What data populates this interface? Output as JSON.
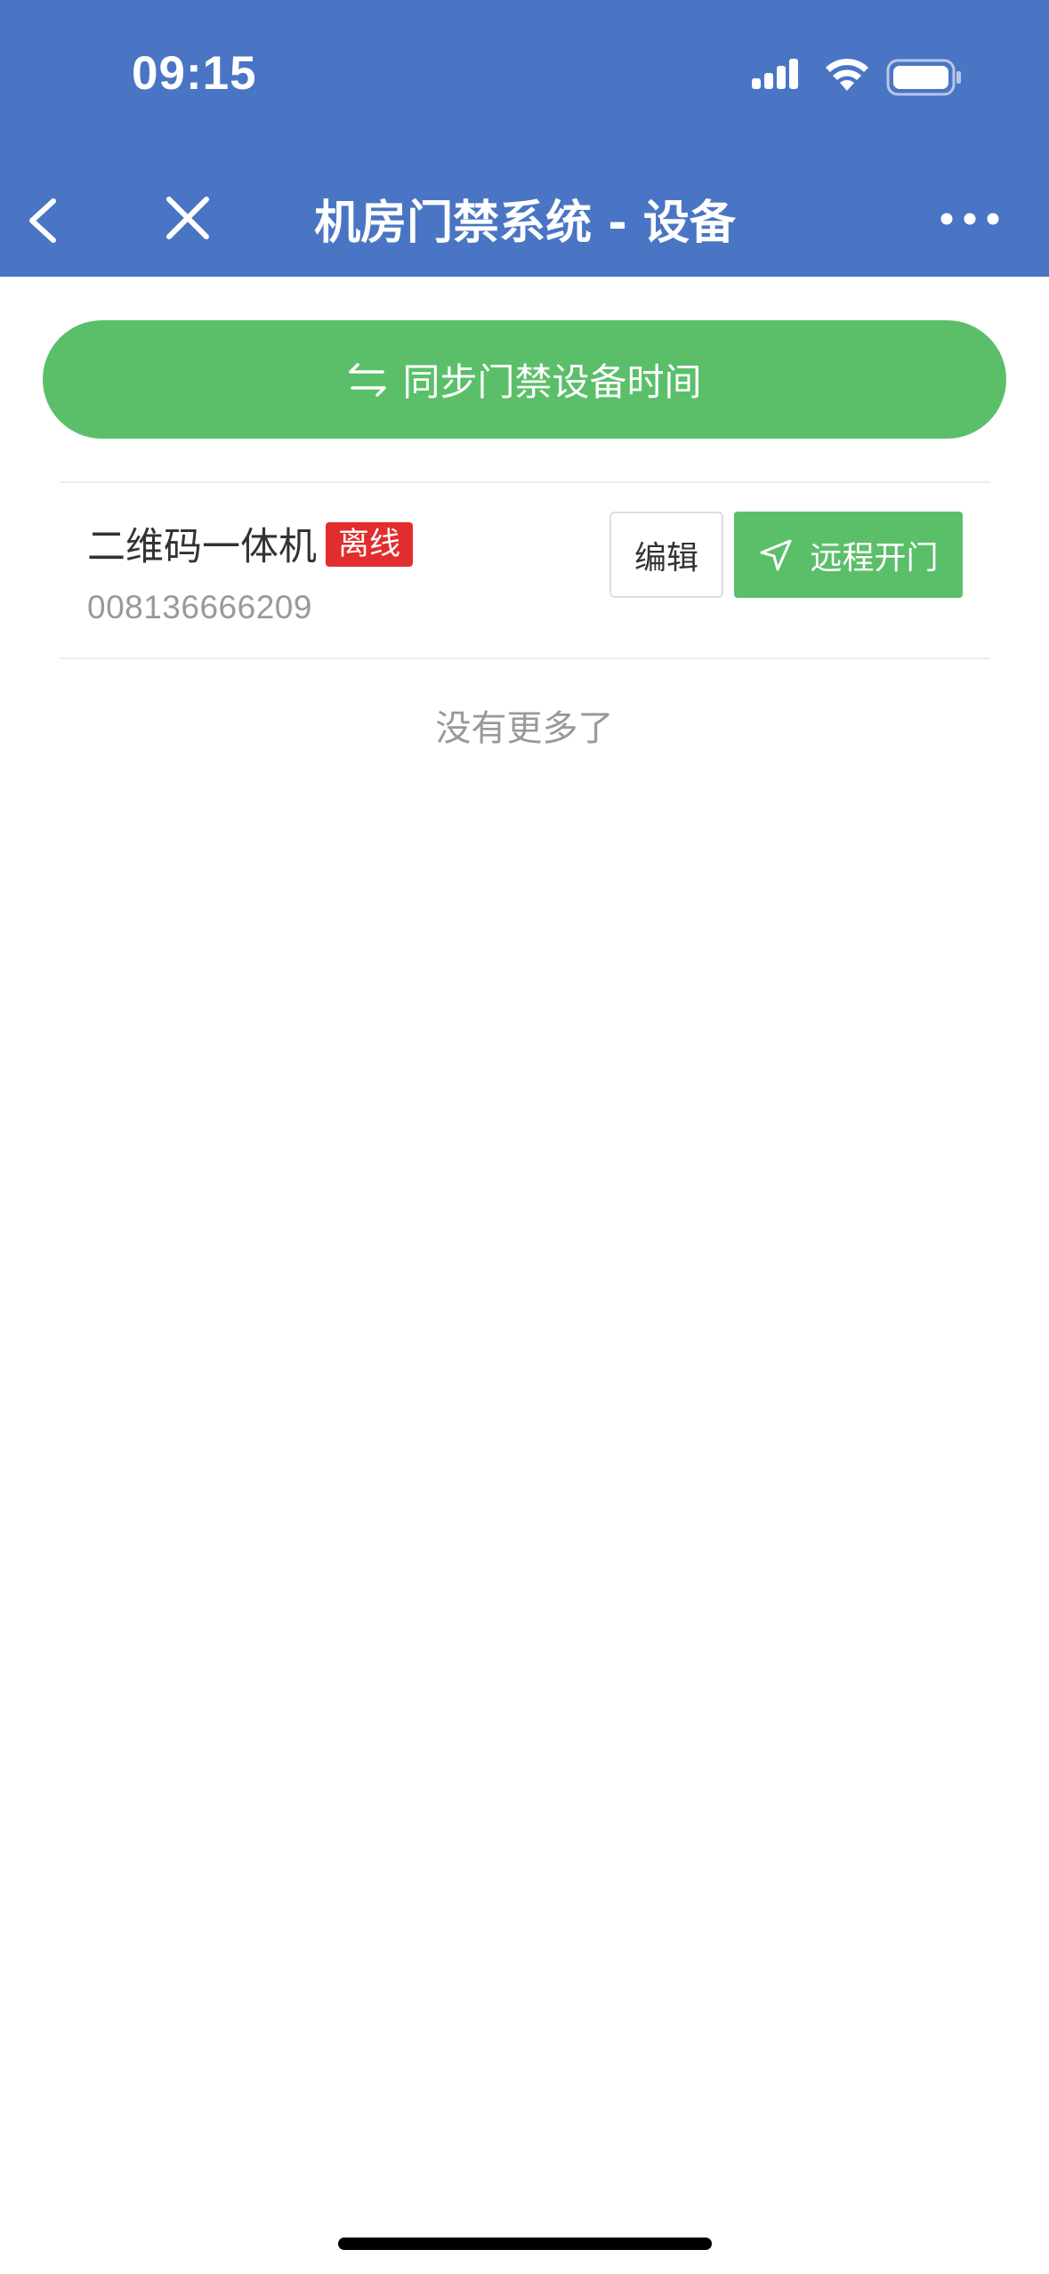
{
  "status_bar": {
    "time": "09:15"
  },
  "nav": {
    "title": "机房门禁系统 - 设备",
    "icons": [
      "chevron-left-icon",
      "close-icon",
      "more-icon"
    ]
  },
  "actions": {
    "sync_label": "同步门禁设备时间"
  },
  "devices": [
    {
      "name": "二维码一体机",
      "status": "离线",
      "serial": "008136666209",
      "edit_label": "编辑",
      "open_label": "远程开门"
    }
  ],
  "list": {
    "end_text": "没有更多了"
  },
  "colors": {
    "nav_bg": "#4a75c4",
    "primary_green": "#5bbf6a",
    "offline_red": "#e12d2d"
  }
}
